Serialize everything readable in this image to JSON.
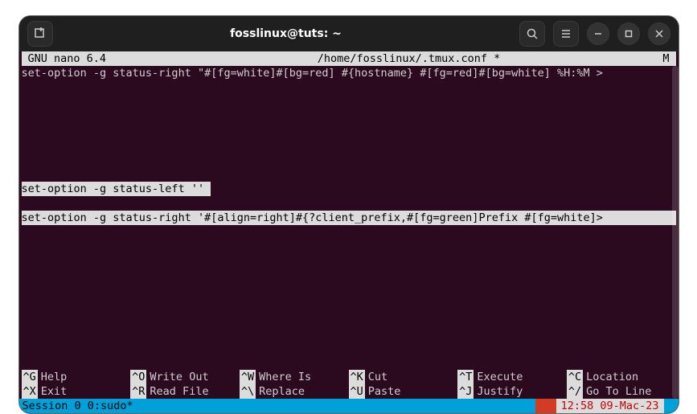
{
  "titlebar": {
    "title": "fosslinux@tuts: ~"
  },
  "nano": {
    "app": "GNU nano 6.4",
    "filepath": "/home/fosslinux/.tmux.conf *",
    "modified": "M"
  },
  "lines": {
    "l1": "set-option -g status-right \"#[fg=white]#[bg=red] #{hostname} #[fg=red]#[bg=white] %H:%M >",
    "l2_text": "set-option -g status-left '' ",
    "l3_text": "set-option -g status-right '#[align=right]#{?client_prefix,#[fg=green]Prefix #[fg=white]>"
  },
  "shortcuts": {
    "r1": [
      {
        "key": "^G",
        "label": "Help"
      },
      {
        "key": "^O",
        "label": "Write Out"
      },
      {
        "key": "^W",
        "label": "Where Is"
      },
      {
        "key": "^K",
        "label": "Cut"
      },
      {
        "key": "^T",
        "label": "Execute"
      },
      {
        "key": "^C",
        "label": "Location"
      }
    ],
    "r2": [
      {
        "key": "^X",
        "label": "Exit"
      },
      {
        "key": "^R",
        "label": "Read File"
      },
      {
        "key": "^\\",
        "label": "Replace"
      },
      {
        "key": "^U",
        "label": "Paste"
      },
      {
        "key": "^J",
        "label": "Justify"
      },
      {
        "key": "^/",
        "label": "Go To Line"
      }
    ]
  },
  "tmux": {
    "session": "Session 0 0:sudo*",
    "time": "12:58 09-Mac-23"
  }
}
